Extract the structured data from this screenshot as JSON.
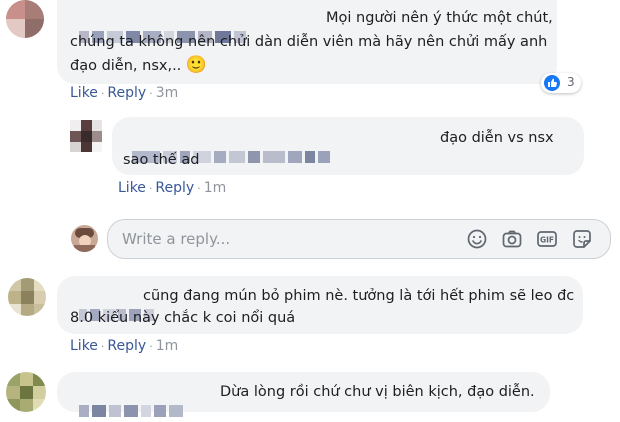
{
  "comments": [
    {
      "text_line1": "Mọi người nên ý thức một chút,",
      "text_line2": "chúng ta không nên chửi dàn diễn viên mà hãy nên chửi mấy anh",
      "text_line3": "đạo diễn, nsx,..",
      "emoji": "🙂",
      "like": "Like",
      "reply": "Reply",
      "time": "3m",
      "reaction_count": "3"
    },
    {
      "text_line1": "đạo diễn vs nsx",
      "text_line2": "sao thế ad",
      "like": "Like",
      "reply": "Reply",
      "time": "1m"
    },
    {
      "text_line1": "cũng đang mún bỏ phim nè. tưởng là tới hết phim sẽ leo đc",
      "text_line2": "8.0 kiểu này chắc k coi nổi quá",
      "like": "Like",
      "reply": "Reply",
      "time": "1m"
    },
    {
      "text_line1": "Dừa lòng rồi chứ chư vị biên kịch, đạo diễn."
    }
  ],
  "reply_box": {
    "placeholder": "Write a reply...",
    "tools": [
      "emoji-icon",
      "camera-icon",
      "gif-icon",
      "sticker-icon"
    ]
  },
  "colors": {
    "link": "#385898",
    "bubble": "#f2f3f5",
    "like_blue": "#1877f2",
    "muted": "#90949c"
  }
}
